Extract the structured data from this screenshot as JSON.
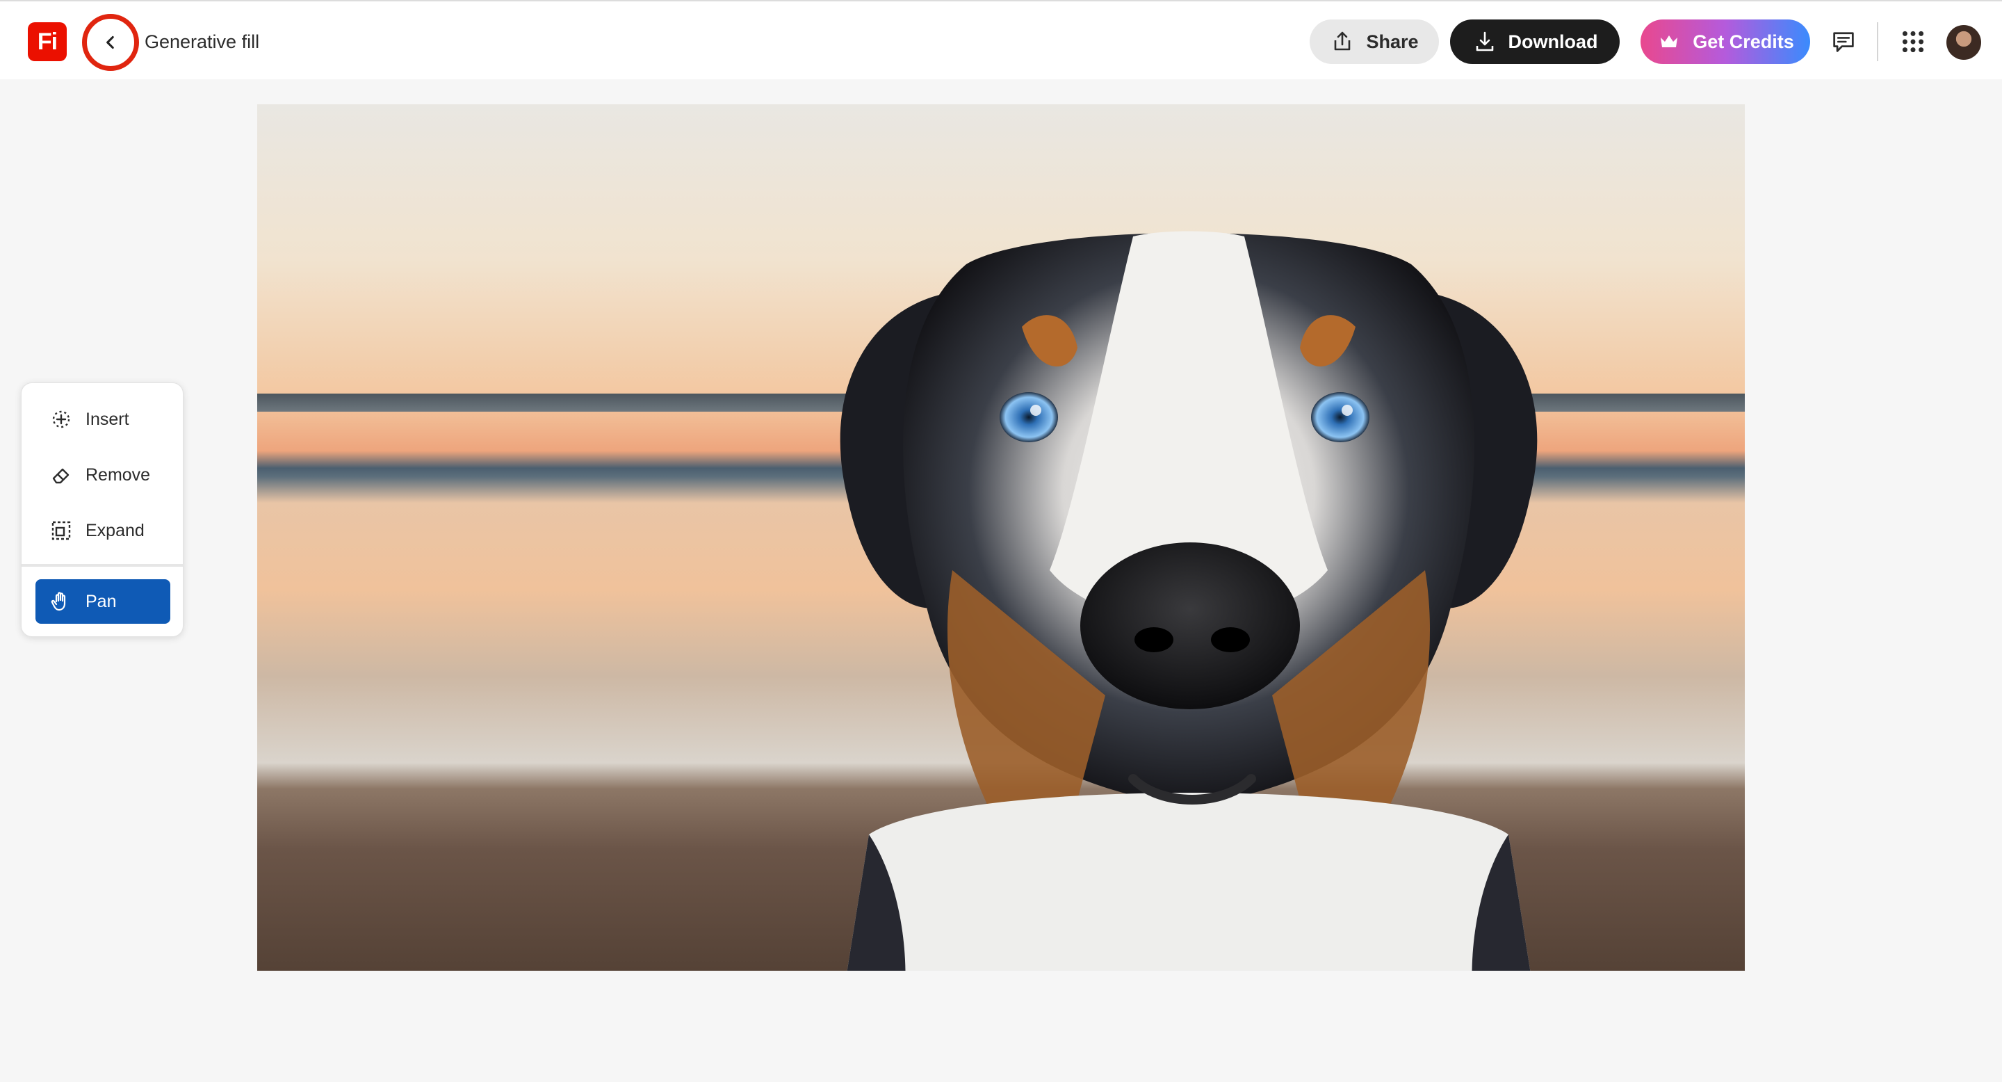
{
  "header": {
    "logo_text": "Fi",
    "title": "Generative fill",
    "share_label": "Share",
    "download_label": "Download",
    "credits_label": "Get Credits",
    "back_icon": "chevron-left-icon",
    "feedback_icon": "chat-icon",
    "apps_icon": "grid-icon"
  },
  "tools": {
    "items": [
      {
        "label": "Insert",
        "icon": "insert-icon"
      },
      {
        "label": "Remove",
        "icon": "eraser-icon"
      },
      {
        "label": "Expand",
        "icon": "expand-icon"
      },
      {
        "label": "Pan",
        "icon": "hand-icon",
        "selected": true
      }
    ]
  },
  "colors": {
    "accent": "#0f5ab5",
    "brand": "#eb1000",
    "highlight_ring": "#e0250f"
  }
}
